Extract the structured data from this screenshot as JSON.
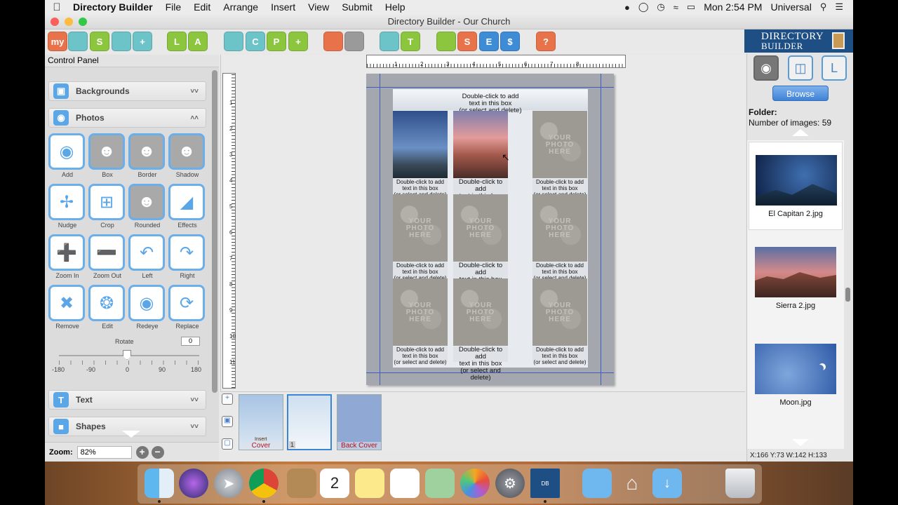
{
  "menubar": {
    "app_name": "Directory Builder",
    "items": [
      "File",
      "Edit",
      "Arrange",
      "Insert",
      "View",
      "Submit",
      "Help"
    ],
    "clock": "Mon 2:54 PM",
    "user": "Universal"
  },
  "window": {
    "title": "Directory Builder - Our Church"
  },
  "toolbar": {
    "buttons": [
      {
        "label": "my",
        "color": "#e8734a"
      },
      {
        "label": "",
        "color": "#6cc3c8"
      },
      {
        "label": "S",
        "color": "#8cc63f"
      },
      {
        "label": "",
        "color": "#6cc3c8"
      },
      {
        "label": "+",
        "color": "#6cc3c8"
      },
      {
        "label": "L",
        "color": "#8cc63f"
      },
      {
        "label": "A",
        "color": "#8cc63f"
      },
      {
        "label": "",
        "color": "#6cc3c8"
      },
      {
        "label": "C",
        "color": "#6cc3c8"
      },
      {
        "label": "P",
        "color": "#8cc63f"
      },
      {
        "label": "+",
        "color": "#8cc63f"
      },
      {
        "label": "",
        "color": "#e8734a"
      },
      {
        "label": "",
        "color": "#9a9a9a"
      },
      {
        "label": "",
        "color": "#6cc3c8"
      },
      {
        "label": "T",
        "color": "#8cc63f"
      },
      {
        "label": "",
        "color": "#8cc63f"
      },
      {
        "label": "S",
        "color": "#e8734a"
      },
      {
        "label": "E",
        "color": "#3e8bd6"
      },
      {
        "label": "$",
        "color": "#3e8bd6"
      },
      {
        "label": "?",
        "color": "#e8734a"
      }
    ]
  },
  "logo": {
    "line1": "DIRECTORY",
    "line2": "BUILDER"
  },
  "control_panel": {
    "title": "Control Panel",
    "sections": {
      "backgrounds": "Backgrounds",
      "photos": "Photos",
      "text": "Text",
      "shapes": "Shapes"
    },
    "photo_tools": [
      {
        "label": "Add",
        "icon": "camera-icon"
      },
      {
        "label": "Box",
        "icon": "person-box-icon"
      },
      {
        "label": "Border",
        "icon": "person-border-icon"
      },
      {
        "label": "Shadow",
        "icon": "person-shadow-icon"
      },
      {
        "label": "Nudge",
        "icon": "nudge-arrows-icon"
      },
      {
        "label": "Crop",
        "icon": "crop-icon"
      },
      {
        "label": "Rounded",
        "icon": "person-rounded-icon"
      },
      {
        "label": "Effects",
        "icon": "effects-icon"
      },
      {
        "label": "Zoom In",
        "icon": "plus-icon"
      },
      {
        "label": "Zoom Out",
        "icon": "minus-icon"
      },
      {
        "label": "Left",
        "icon": "rotate-left-icon"
      },
      {
        "label": "Right",
        "icon": "rotate-right-icon"
      },
      {
        "label": "Remove",
        "icon": "x-icon"
      },
      {
        "label": "Edit",
        "icon": "aperture-icon"
      },
      {
        "label": "Redeye",
        "icon": "eye-icon"
      },
      {
        "label": "Replace",
        "icon": "refresh-icon"
      }
    ],
    "rotate": {
      "label": "Rotate",
      "value": "0",
      "ticks": [
        "-180",
        "-90",
        "0",
        "90",
        "180"
      ]
    },
    "zoom": {
      "label": "Zoom:",
      "value": "82%"
    }
  },
  "page": {
    "top_text": [
      "Double-click to add",
      "text in this box",
      "(or select and delete)"
    ],
    "placeholder": [
      "YOUR",
      "PHOTO",
      "HERE"
    ],
    "caption_small": [
      "Double-click to add",
      "text in this box",
      "(or select and delete)"
    ]
  },
  "ruler": {
    "h_numbers": [
      "1",
      "2",
      "3",
      "4",
      "5",
      "6",
      "7",
      "8"
    ],
    "v_numbers": [
      "1",
      "2",
      "3",
      "4",
      "5",
      "6",
      "7",
      "8",
      "9",
      "10",
      "11"
    ]
  },
  "thumbnails": [
    {
      "label": "Cover",
      "badge": "Insert"
    },
    {
      "label": "",
      "badge": "1"
    },
    {
      "label": "Back Cover",
      "badge": ""
    }
  ],
  "right_panel": {
    "browse_label": "Browse",
    "folder_label": "Folder:",
    "count_label": "Number of images: 59",
    "images": [
      "El Capitan 2.jpg",
      "Sierra 2.jpg",
      "Moon.jpg"
    ],
    "coords": "X:166  Y:73  W:142  H:133"
  }
}
